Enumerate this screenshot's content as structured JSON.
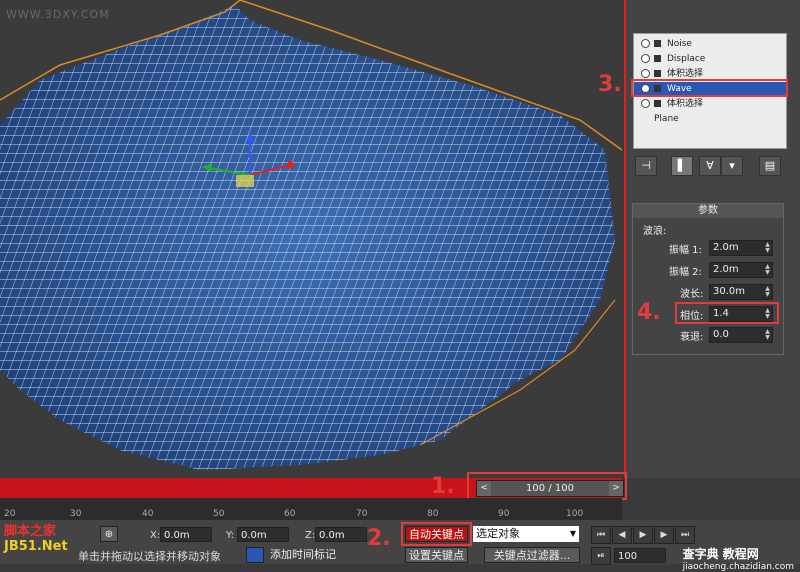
{
  "viewport": {
    "watermark": "WWW.3DXY.COM"
  },
  "modifier_stack": {
    "items": [
      {
        "label": "Noise"
      },
      {
        "label": "Displace"
      },
      {
        "label": "体积选择"
      },
      {
        "label": "Wave",
        "selected": true
      },
      {
        "label": "体积选择"
      },
      {
        "label": "Plane"
      }
    ]
  },
  "params": {
    "title": "参数",
    "group": "波浪:",
    "rows": [
      {
        "label": "振幅 1:",
        "value": "2.0m"
      },
      {
        "label": "振幅 2:",
        "value": "2.0m"
      },
      {
        "label": "波长:",
        "value": "30.0m"
      },
      {
        "label": "相位:",
        "value": "1.4"
      },
      {
        "label": "衰退:",
        "value": "0.0"
      }
    ]
  },
  "time_slider": {
    "label": "100 / 100",
    "prev": "<",
    "next": ">"
  },
  "ruler_ticks": [
    "20",
    "30",
    "40",
    "50",
    "60",
    "70",
    "80",
    "90",
    "100"
  ],
  "coords": {
    "x_label": "X:",
    "x": "0.0m",
    "y_label": "Y:",
    "y": "0.0m",
    "z_label": "Z:",
    "z": "0.0m"
  },
  "buttons": {
    "auto_key": "自动关键点",
    "set_key": "设置关键点",
    "selection": "选定对象",
    "key_filters": "关键点过滤器...",
    "add_time_tag": "添加时间标记"
  },
  "status": {
    "prompt": "单击并拖动以选择并移动对象"
  },
  "frame_field": "100",
  "annotations": {
    "n1": "1.",
    "n2": "2.",
    "n3": "3.",
    "n4": "4."
  },
  "branding": {
    "jb51_top": "脚本之家",
    "jb51_bottom": "JB51.Net",
    "site": "jiaocheng.chazidian.com",
    "site_cn": "查字典 教程网"
  },
  "colors": {
    "accent_red": "#e23b3b",
    "timeline_red": "#c8131a",
    "mesh_blue": "#2f5c9c",
    "selection_blue": "#2a57b4"
  }
}
